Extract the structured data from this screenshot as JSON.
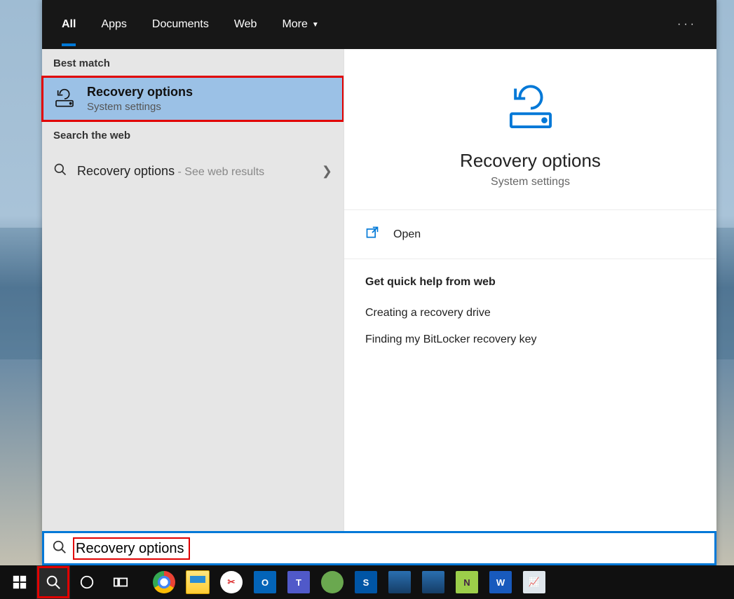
{
  "tabs": {
    "all": "All",
    "apps": "Apps",
    "documents": "Documents",
    "web": "Web",
    "more": "More"
  },
  "left": {
    "best_match_label": "Best match",
    "item": {
      "title": "Recovery options",
      "subtitle": "System settings"
    },
    "search_web_label": "Search the web",
    "web_item": {
      "text": "Recovery options",
      "suffix": " - See web results"
    }
  },
  "right": {
    "title": "Recovery options",
    "subtitle": "System settings",
    "open_label": "Open",
    "help_heading": "Get quick help from web",
    "help_links": [
      "Creating a recovery drive",
      "Finding my BitLocker recovery key"
    ]
  },
  "search": {
    "value": "Recovery options"
  },
  "taskbar_apps": [
    "Chrome",
    "Explorer",
    "Snip",
    "Outlook",
    "Teams",
    "GlobalProtect",
    "Sophos",
    "Remote",
    "Remote2",
    "Notepad++",
    "Word",
    "ResMon"
  ],
  "colors": {
    "accent": "#0078d7",
    "highlight": "#e10000"
  }
}
